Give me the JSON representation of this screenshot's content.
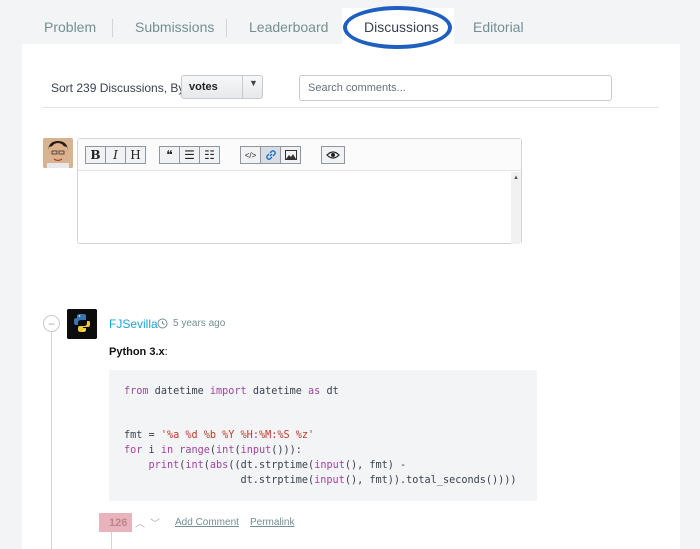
{
  "tabs": [
    {
      "label": "Problem"
    },
    {
      "label": "Submissions"
    },
    {
      "label": "Leaderboard"
    },
    {
      "label": "Discussions",
      "active": true
    },
    {
      "label": "Editorial"
    }
  ],
  "sort": {
    "label": "Sort 239 Discussions, By:",
    "selected": "votes"
  },
  "search": {
    "placeholder": "Search comments..."
  },
  "editor": {
    "toolbar": {
      "bold": "B",
      "italic": "I",
      "heading": "H",
      "quote": "❝",
      "bullet_list": "☰",
      "numbered_list": "☷",
      "code": "</>",
      "link": "🔗",
      "image": "▣",
      "preview": "◉"
    }
  },
  "comment": {
    "username": "FJSevilla",
    "time": "5 years ago",
    "language": "Python 3.x",
    "code_lines": [
      "from datetime import datetime as dt",
      "",
      "",
      "fmt = '%a %d %b %Y %H:%M:%S %z'",
      "for i in range(int(input())):",
      "    print(int(abs((dt.strptime(input(), fmt) -",
      "                   dt.strptime(input(), fmt)).total_seconds())))"
    ],
    "votes": "126",
    "add_comment": "Add Comment",
    "permalink": "Permalink"
  },
  "colors": {
    "accent_link": "#1ba3dd",
    "highlight_circle": "#1f5fbf",
    "votes_badge": "#e8b3bd"
  }
}
